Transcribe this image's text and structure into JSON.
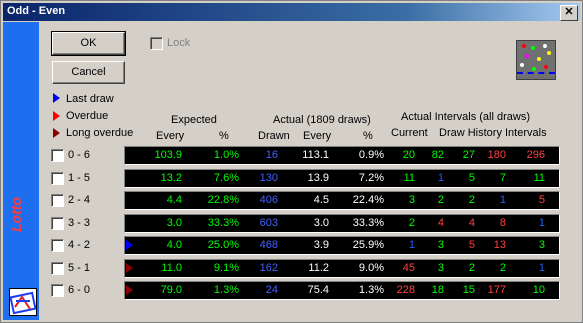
{
  "window": {
    "title": "Odd - Even",
    "close_glyph": "✕"
  },
  "sidebar": {
    "vertical_text": "Lotto"
  },
  "buttons": {
    "ok": "OK",
    "cancel": "Cancel"
  },
  "lock": {
    "label": "Lock"
  },
  "legend": {
    "last_draw": "Last draw",
    "overdue": "Overdue",
    "long_overdue": "Long overdue",
    "colors": {
      "last_draw": "#0000ff",
      "overdue": "#ff0000",
      "long_overdue": "#8b0000"
    }
  },
  "headers": {
    "expected": "Expected",
    "actual": "Actual (1809 draws)",
    "intervals": "Actual Intervals (all draws)",
    "every": "Every",
    "pct": "%",
    "drawn": "Drawn",
    "every2": "Every",
    "pct2": "%",
    "current": "Current",
    "history": "Draw History Intervals"
  },
  "rows": [
    {
      "label": "0 - 6",
      "marker": "",
      "exp_every": "103.9",
      "exp_pct": "1.0%",
      "drawn": "16",
      "act_every": "113.1",
      "act_pct": "0.9%",
      "current": {
        "v": "20",
        "c": "#00ff00"
      },
      "hist": [
        {
          "v": "82",
          "c": "#00ff00"
        },
        {
          "v": "27",
          "c": "#00ff00"
        },
        {
          "v": "180",
          "c": "#ff4040"
        },
        {
          "v": "296",
          "c": "#ff4040"
        }
      ]
    },
    {
      "label": "1 - 5",
      "marker": "",
      "exp_every": "13.2",
      "exp_pct": "7.6%",
      "drawn": "130",
      "act_every": "13.9",
      "act_pct": "7.2%",
      "current": {
        "v": "11",
        "c": "#00ff00"
      },
      "hist": [
        {
          "v": "1",
          "c": "#2060ff"
        },
        {
          "v": "5",
          "c": "#00ff00"
        },
        {
          "v": "7",
          "c": "#00ff00"
        },
        {
          "v": "11",
          "c": "#00ff00"
        }
      ]
    },
    {
      "label": "2 - 4",
      "marker": "",
      "exp_every": "4.4",
      "exp_pct": "22.8%",
      "drawn": "406",
      "act_every": "4.5",
      "act_pct": "22.4%",
      "current": {
        "v": "3",
        "c": "#00ff00"
      },
      "hist": [
        {
          "v": "2",
          "c": "#00ff00"
        },
        {
          "v": "2",
          "c": "#00ff00"
        },
        {
          "v": "1",
          "c": "#2060ff"
        },
        {
          "v": "5",
          "c": "#ff4040"
        }
      ]
    },
    {
      "label": "3 - 3",
      "marker": "",
      "exp_every": "3.0",
      "exp_pct": "33.3%",
      "drawn": "603",
      "act_every": "3.0",
      "act_pct": "33.3%",
      "current": {
        "v": "2",
        "c": "#00ff00"
      },
      "hist": [
        {
          "v": "4",
          "c": "#ff4040"
        },
        {
          "v": "4",
          "c": "#ff4040"
        },
        {
          "v": "8",
          "c": "#ff4040"
        },
        {
          "v": "1",
          "c": "#2060ff"
        }
      ]
    },
    {
      "label": "4 - 2",
      "marker": "last",
      "exp_every": "4.0",
      "exp_pct": "25.0%",
      "drawn": "468",
      "act_every": "3.9",
      "act_pct": "25.9%",
      "current": {
        "v": "1",
        "c": "#2060ff"
      },
      "hist": [
        {
          "v": "3",
          "c": "#00ff00"
        },
        {
          "v": "5",
          "c": "#ff4040"
        },
        {
          "v": "13",
          "c": "#ff4040"
        },
        {
          "v": "3",
          "c": "#00ff00"
        }
      ]
    },
    {
      "label": "5 - 1",
      "marker": "long",
      "exp_every": "11.0",
      "exp_pct": "9.1%",
      "drawn": "162",
      "act_every": "11.2",
      "act_pct": "9.0%",
      "current": {
        "v": "45",
        "c": "#ff4040"
      },
      "hist": [
        {
          "v": "3",
          "c": "#00ff00"
        },
        {
          "v": "2",
          "c": "#00ff00"
        },
        {
          "v": "2",
          "c": "#00ff00"
        },
        {
          "v": "1",
          "c": "#2060ff"
        }
      ]
    },
    {
      "label": "6 - 0",
      "marker": "long",
      "exp_every": "79.0",
      "exp_pct": "1.3%",
      "drawn": "24",
      "act_every": "75.4",
      "act_pct": "1.3%",
      "current": {
        "v": "228",
        "c": "#ff4040"
      },
      "hist": [
        {
          "v": "18",
          "c": "#00ff00"
        },
        {
          "v": "15",
          "c": "#00ff00"
        },
        {
          "v": "177",
          "c": "#ff4040"
        },
        {
          "v": "10",
          "c": "#00ff00"
        }
      ]
    }
  ]
}
